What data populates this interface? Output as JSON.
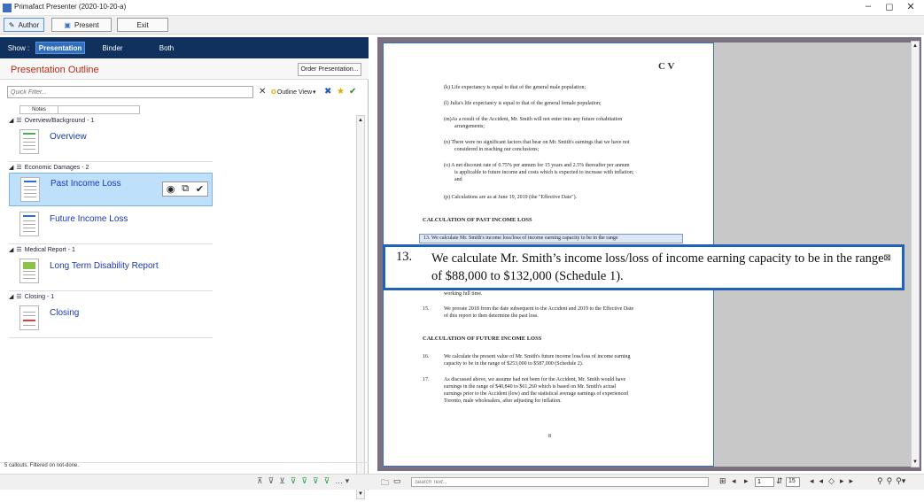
{
  "app": {
    "title": "Primafact Presenter (2020-10-20-a)",
    "accent": "#10305e",
    "window_controls": [
      "–",
      "◻",
      "✕"
    ]
  },
  "toolbar": {
    "author_label": "Author",
    "present_label": "Present",
    "exit_label": "Exit"
  },
  "show": {
    "label": "Show :",
    "options": [
      "Presentation",
      "Binder",
      "Both"
    ],
    "selected": "Presentation"
  },
  "outline": {
    "title": "Presentation Outline",
    "order_button": "Order Presentation...",
    "filter_placeholder": "Quick Filter...",
    "view_menu": "Outline View",
    "notes_header": "Notes",
    "sections": [
      {
        "label": "Overview/Background - 1",
        "items": [
          {
            "label": "Overview",
            "color": "#4caf50",
            "selected": false
          }
        ]
      },
      {
        "label": "Economic Damages - 2",
        "items": [
          {
            "label": "Past Income Loss",
            "color": "#2b6cd6",
            "selected": true
          },
          {
            "label": "Future Income Loss",
            "color": "#2b6cd6",
            "selected": false
          }
        ]
      },
      {
        "label": "Medical Report - 1",
        "items": [
          {
            "label": "Long Term Disability Report",
            "color": "#8bc34a",
            "selected": false
          }
        ]
      },
      {
        "label": "Closing - 1",
        "items": [
          {
            "label": "Closing",
            "color": "#e53935",
            "selected": false
          }
        ]
      }
    ],
    "status": "5 callouts.  Filtered on not-done."
  },
  "document": {
    "logo": "C V",
    "lines": [
      "(k) Life expectancy is equal to that of the general male population;",
      "(l) Julia's life expectancy is equal to that of the general female population;",
      "(m)As a result of the Accident, Mr. Smith will not enter into any future cohabitation",
      "arrangements;",
      "(n) There were no significant factors that bear on Mr. Smith's earnings that we have not",
      "considered in reaching our conclusions;",
      "(o) A net discount rate of 0.75% per annum for 15 years and 2.5% thereafter per annum",
      "is applicable to future income and costs which is expected to increase with inflation;",
      "and",
      "(p) Calculations are as at June 19, 2019 (the \"Effective Date\").",
      "CALCULATION OF PAST INCOME LOSS",
      "13.      We calculate Mr. Smith's income loss/loss of income earning capacity to be in the range",
      "working full time.",
      "15.",
      "We prorate 2018 from the date subsequent to the Accident and 2019 to the Effective Date",
      "of this report to then determine the past loss.",
      "CALCULATION OF FUTURE INCOME LOSS",
      "16.",
      "We calculate the present value of Mr. Smith's future income loss/loss of income earning",
      "capacity to be in the range of $253,000 to $587,000 (Schedule 2).",
      "17.",
      "As discussed above, we assume had not been for the Accident, Mr. Smith would have",
      "earnings in the range of $40,840 to $61,260 which is based on Mr. Smith's actual",
      "earnings prior to the Accident (low) and the statistical average earnings of experienced",
      "Toronto, male wholesalers, after adjusting for inflation.",
      "8"
    ],
    "callout_number": "13.",
    "callout_text": "We calculate Mr. Smith’s income loss/loss of income earning capacity to be in the range of $88,000 to $132,000 (Schedule 1)."
  },
  "bottom": {
    "search_placeholder": "Search Text...",
    "page_current": "1",
    "page_total": "15"
  }
}
